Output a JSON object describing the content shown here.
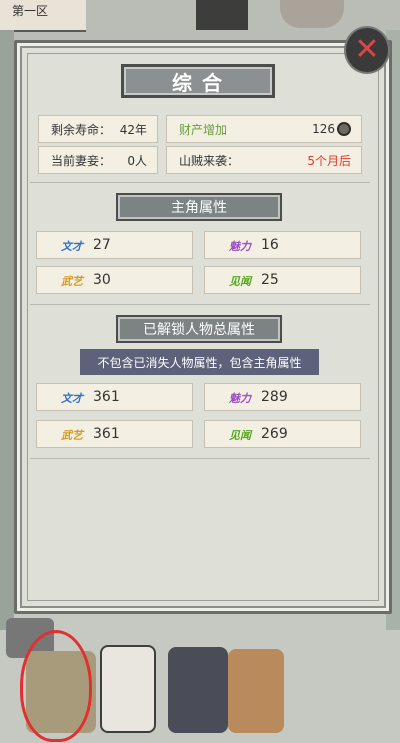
{
  "topbar": {
    "label": "第一区"
  },
  "panel": {
    "title": "综合",
    "info": {
      "lifespan_label": "剩余寿命：",
      "lifespan_value": "42年",
      "wealth_label": "财产增加",
      "wealth_value": "126",
      "spouse_label": "当前妻妾：",
      "spouse_value": "0人",
      "bandit_label": "山贼来袭：",
      "bandit_value": "5个月后"
    },
    "protagonist": {
      "title": "主角属性",
      "stats": [
        {
          "tag": "文才",
          "value": "27"
        },
        {
          "tag": "魅力",
          "value": "16"
        },
        {
          "tag": "武艺",
          "value": "30"
        },
        {
          "tag": "见闻",
          "value": "25"
        }
      ]
    },
    "unlocked": {
      "title": "已解锁人物总属性",
      "note": "不包含已消失人物属性，包含主角属性",
      "stats": [
        {
          "tag": "文才",
          "value": "361"
        },
        {
          "tag": "魅力",
          "value": "289"
        },
        {
          "tag": "武艺",
          "value": "361"
        },
        {
          "tag": "见闻",
          "value": "269"
        }
      ]
    }
  },
  "close_glyph": "✕",
  "colors": {
    "wealth_green": "#6a9c3a",
    "bandit_red": "#e23b2b",
    "annotation_circle": "#e03030"
  }
}
